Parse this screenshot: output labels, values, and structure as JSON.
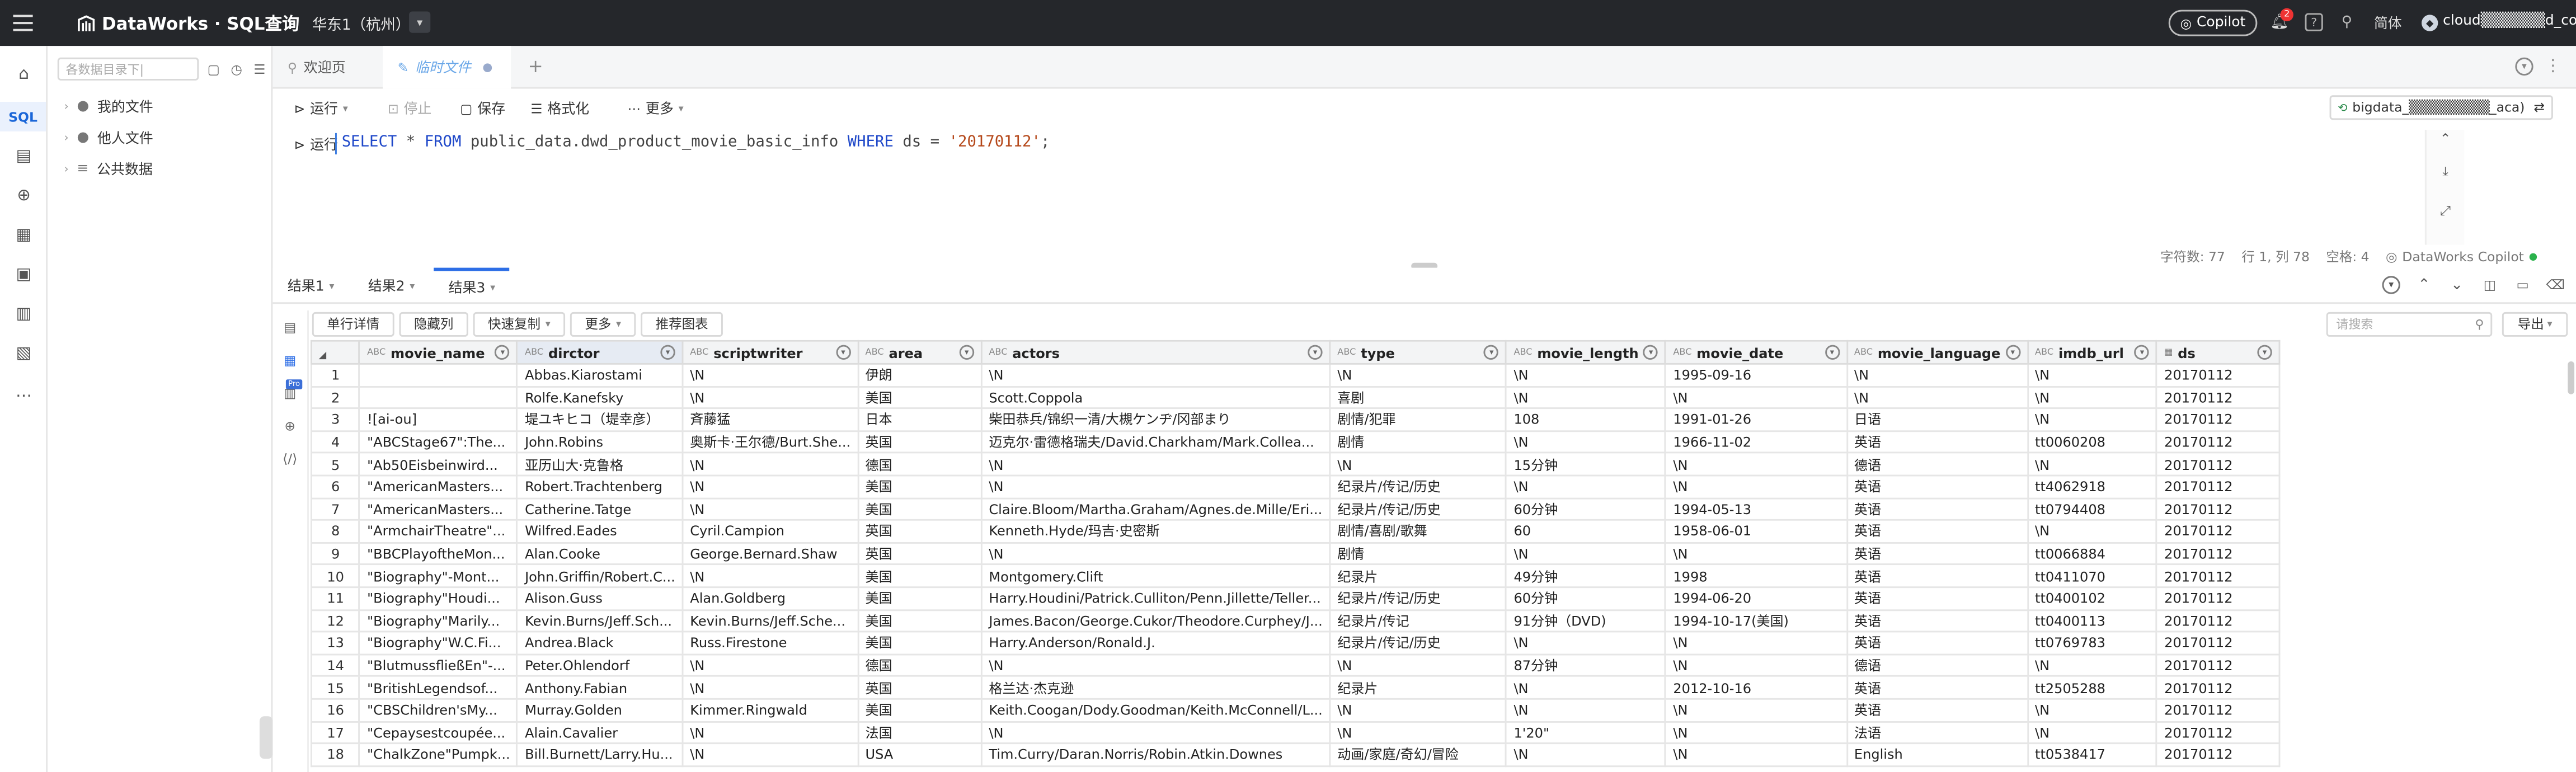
{
  "topbar": {
    "app_title": "DataWorks · SQL查询",
    "region": "华东1（杭州）",
    "copilot_label": "Copilot",
    "notif_count": "2",
    "lang": "简体",
    "account": "cloud▒▒▒▒▒▒d_com"
  },
  "tree": {
    "search_placeholder": "各数据目录下|",
    "nodes": [
      {
        "label": "我的文件",
        "icon": "user-icon"
      },
      {
        "label": "他人文件",
        "icon": "users-icon"
      },
      {
        "label": "公共数据",
        "icon": "database-icon"
      }
    ]
  },
  "rail": {
    "sql_label": "SQL"
  },
  "tabs": [
    {
      "label": "欢迎页"
    },
    {
      "label": "临时文件"
    }
  ],
  "toolbar": {
    "run": "运行",
    "stop": "停止",
    "save": "保存",
    "format": "格式化",
    "more": "更多",
    "connection": "bigdata_▒▒▒▒▒▒▒▒_aca)"
  },
  "editor": {
    "run_label": "运行",
    "code_kw1": "SELECT",
    "code_mid1": " * ",
    "code_kw2": "FROM",
    "code_mid2": " public_data.dwd_product_movie_basic_info ",
    "code_kw3": "WHERE",
    "code_mid3": " ds = ",
    "code_str": "'20170112'",
    "code_end": ";"
  },
  "status": {
    "chars": "字符数: 77",
    "pos": "行 1, 列 78",
    "space": "空格: 4",
    "copilot": "DataWorks Copilot"
  },
  "result_tabs": [
    "结果1",
    "结果2",
    "结果3"
  ],
  "result_toolbar": {
    "row_detail": "单行详情",
    "hide_col": "隐藏列",
    "quick_copy": "快速复制",
    "more": "更多",
    "recommend_chart": "推荐图表",
    "search_placeholder": "请搜索",
    "export": "导出"
  },
  "table": {
    "columns": [
      "movie_name",
      "dirctor",
      "scriptwriter",
      "area",
      "actors",
      "type",
      "movie_length",
      "movie_date",
      "movie_language",
      "imdb_url",
      "ds"
    ],
    "rows": [
      [
        "1",
        "",
        "Abbas.Kiarostami",
        "\\N",
        "伊朗",
        "\\N",
        "\\N",
        "\\N",
        "1995-09-16",
        "\\N",
        "\\N",
        "20170112"
      ],
      [
        "2",
        "",
        "Rolfe.Kanefsky",
        "\\N",
        "美国",
        "Scott.Coppola",
        "喜剧",
        "\\N",
        "\\N",
        "\\N",
        "\\N",
        "20170112"
      ],
      [
        "3",
        "![ai-ou]",
        "堤ユキヒコ（堤幸彦）",
        "斉藤猛",
        "日本",
        "柴田恭兵/锦织一清/大槻ケンヂ/冈部まり",
        "剧情/犯罪",
        "108",
        "1991-01-26",
        "日语",
        "\\N",
        "20170112"
      ],
      [
        "4",
        "\"ABCStage67\":The...",
        "John.Robins",
        "奥斯卡·王尔德/Burt.She...",
        "英国",
        "迈克尔·雷德格瑞夫/David.Charkham/Mark.Collea...",
        "剧情",
        "\\N",
        "1966-11-02",
        "英语",
        "tt0060208",
        "20170112"
      ],
      [
        "5",
        "\"Ab50Eisbeinwird...",
        "亚历山大·克鲁格",
        "\\N",
        "德国",
        "\\N",
        "\\N",
        "15分钟",
        "\\N",
        "德语",
        "\\N",
        "20170112"
      ],
      [
        "6",
        "\"AmericanMasters...",
        "Robert.Trachtenberg",
        "\\N",
        "美国",
        "\\N",
        "纪录片/传记/历史",
        "\\N",
        "\\N",
        "英语",
        "tt4062918",
        "20170112"
      ],
      [
        "7",
        "\"AmericanMasters...",
        "Catherine.Tatge",
        "\\N",
        "美国",
        "Claire.Bloom/Martha.Graham/Agnes.de.Mille/Eri...",
        "纪录片/传记/历史",
        "60分钟",
        "1994-05-13",
        "英语",
        "tt0794408",
        "20170112"
      ],
      [
        "8",
        "\"ArmchairTheatre\"...",
        "Wilfred.Eades",
        "Cyril.Campion",
        "英国",
        "Kenneth.Hyde/玛吉·史密斯",
        "剧情/喜剧/歌舞",
        "60",
        "1958-06-01",
        "英语",
        "\\N",
        "20170112"
      ],
      [
        "9",
        "\"BBCPlayoftheMon...",
        "Alan.Cooke",
        "George.Bernard.Shaw",
        "英国",
        "\\N",
        "剧情",
        "\\N",
        "\\N",
        "英语",
        "tt0066884",
        "20170112"
      ],
      [
        "10",
        "\"Biography\"-Mont...",
        "John.Griffin/Robert.C...",
        "\\N",
        "美国",
        "Montgomery.Clift",
        "纪录片",
        "49分钟",
        "1998",
        "英语",
        "tt0411070",
        "20170112"
      ],
      [
        "11",
        "\"Biography\"Houdi...",
        "Alison.Guss",
        "Alan.Goldberg",
        "美国",
        "Harry.Houdini/Patrick.Culliton/Penn.Jillette/Teller...",
        "纪录片/传记/历史",
        "60分钟",
        "1994-06-20",
        "英语",
        "tt0400102",
        "20170112"
      ],
      [
        "12",
        "\"Biography\"Marily...",
        "Kevin.Burns/Jeff.Sch...",
        "Kevin.Burns/Jeff.Sche...",
        "美国",
        "James.Bacon/George.Cukor/Theodore.Curphey/J...",
        "纪录片/传记",
        "91分钟（DVD)",
        "1994-10-17(美国)",
        "英语",
        "tt0400113",
        "20170112"
      ],
      [
        "13",
        "\"Biography\"W.C.Fi...",
        "Andrea.Black",
        "Russ.Firestone",
        "美国",
        "Harry.Anderson/Ronald.J.",
        "纪录片/传记/历史",
        "\\N",
        "\\N",
        "英语",
        "tt0769783",
        "20170112"
      ],
      [
        "14",
        "\"BlutmussfließEn\"-...",
        "Peter.Ohlendorf",
        "\\N",
        "德国",
        "\\N",
        "\\N",
        "87分钟",
        "\\N",
        "德语",
        "\\N",
        "20170112"
      ],
      [
        "15",
        "\"BritishLegendsof...",
        "Anthony.Fabian",
        "\\N",
        "英国",
        "格兰达·杰克逊",
        "纪录片",
        "\\N",
        "2012-10-16",
        "英语",
        "tt2505288",
        "20170112"
      ],
      [
        "16",
        "\"CBSChildren'sMy...",
        "Murray.Golden",
        "Kimmer.Ringwald",
        "美国",
        "Keith.Coogan/Dody.Goodman/Keith.McConnell/L...",
        "\\N",
        "\\N",
        "\\N",
        "英语",
        "\\N",
        "20170112"
      ],
      [
        "17",
        "\"Cepaysestcoupée...",
        "Alain.Cavalier",
        "\\N",
        "法国",
        "\\N",
        "\\N",
        "1'20\"",
        "\\N",
        "法语",
        "\\N",
        "20170112"
      ],
      [
        "18",
        "\"ChalkZone\"Pumpk...",
        "Bill.Burnett/Larry.Hu...",
        "\\N",
        "USA",
        "Tim.Curry/Daran.Norris/Robin.Atkin.Downes",
        "动画/家庭/奇幻/冒险",
        "\\N",
        "\\N",
        "English",
        "tt0538417",
        "20170112"
      ]
    ]
  }
}
